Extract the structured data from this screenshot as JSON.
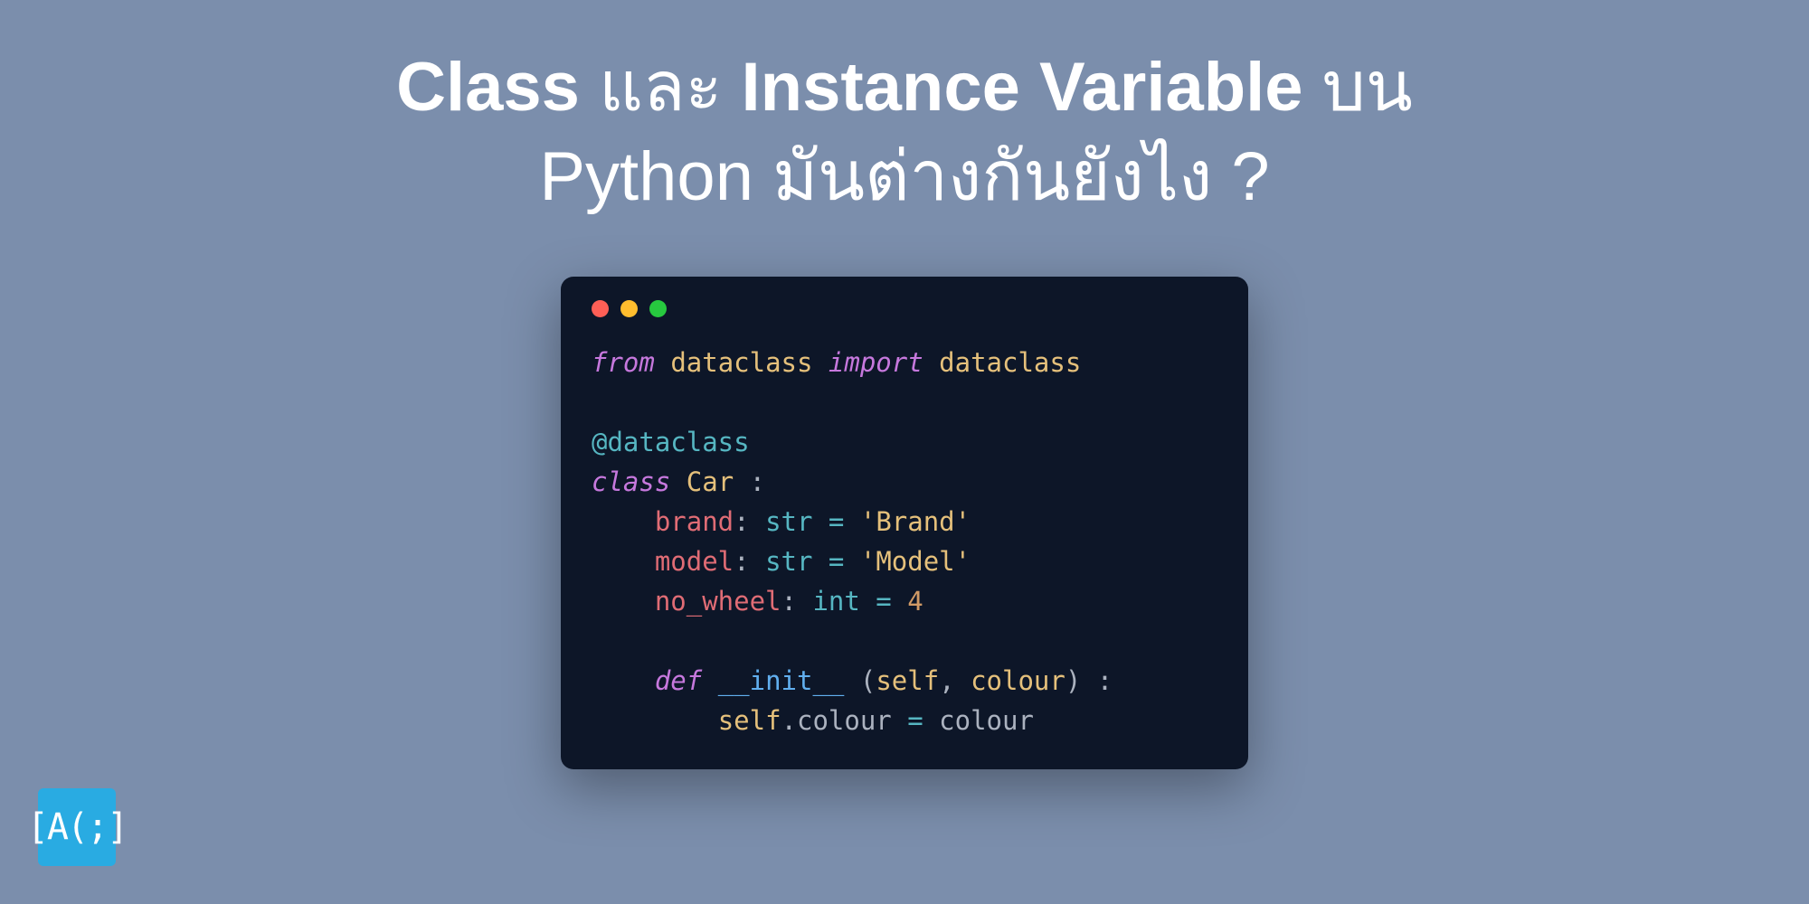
{
  "title": {
    "part1_bold": "Class",
    "part2": " และ ",
    "part3_bold": "Instance Variable",
    "part4": " บน",
    "line2": "Python มันต่างกันยังไง ?"
  },
  "logo": "[A(;]",
  "code": {
    "l1": {
      "from": "from",
      "mod1": "dataclass",
      "import": "import",
      "mod2": "dataclass"
    },
    "l2": "",
    "l3": {
      "deco": "@dataclass"
    },
    "l4": {
      "kwd": "class",
      "name": "Car",
      "colon": " :"
    },
    "l5": {
      "indent": "    ",
      "prop": "brand",
      "colon": ": ",
      "type": "str",
      "eq": " = ",
      "str": "'Brand'"
    },
    "l6": {
      "indent": "    ",
      "prop": "model",
      "colon": ": ",
      "type": "str",
      "eq": " = ",
      "str": "'Model'"
    },
    "l7": {
      "indent": "    ",
      "prop": "no_wheel",
      "colon": ": ",
      "type": "int",
      "eq": " = ",
      "num": "4"
    },
    "l8": "",
    "l9": {
      "indent": "    ",
      "kwd": "def",
      "fn": "__init__",
      "open": " (",
      "p1": "self",
      "comma": ", ",
      "p2": "colour",
      "close": ") :"
    },
    "l10": {
      "indent": "        ",
      "self": "self",
      "dot": ".",
      "prop": "colour",
      "eq": " = ",
      "val": "colour"
    }
  },
  "colors": {
    "background": "#7b8eac",
    "codeBackground": "#0d1628",
    "logoBackground": "#29abe2",
    "titleColor": "#ffffff"
  }
}
